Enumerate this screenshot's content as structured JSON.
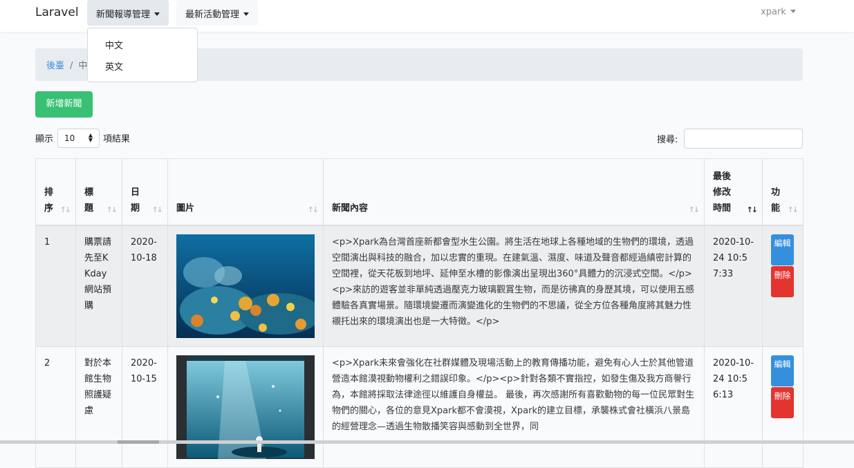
{
  "navbar": {
    "brand": "Laravel",
    "menus": [
      {
        "label": "新聞報導管理"
      },
      {
        "label": "最新活動管理"
      }
    ],
    "user": "xpark",
    "dropdown_items": [
      "中文",
      "英文"
    ]
  },
  "breadcrumb": {
    "home": "後臺",
    "current": "中文"
  },
  "add_button": "新增新聞",
  "length": {
    "prefix": "顯示",
    "value": "10",
    "suffix": "項結果"
  },
  "search": {
    "label": "搜尋:",
    "value": ""
  },
  "table": {
    "headers": [
      "排序",
      "標題",
      "日期",
      "圖片",
      "新聞內容",
      "最後修改時間",
      "功能"
    ],
    "rows": [
      {
        "order": "1",
        "title": "購票請先至KKday網站預購",
        "date": "2020-10-18",
        "image": "coral-reef-image",
        "content": "<p>Xpark為台灣首座新都會型水生公園。將生活在地球上各種地域的生物們的環境，透過空間演出與科技的融合，加以忠實的重現。在建氣溫、濕度、味道及聲音都經過縝密計算的空間裡，從天花板到地坪、延伸至水槽的影像演出呈現出360°具體力的沉浸式空間。</p><p>來訪的遊客並非單純透過壓克力玻璃觀賞生物，而是彷彿真的身歷其境，可以使用五感體驗各真實場景。隨環境變遷而演變進化的生物們的不思議，從全方位各種角度將其魅力性襯托出來的環境演出也是一大特徵。</p>",
        "updated": "2020-10-24 10:57:33",
        "edit": "編輯",
        "delete": "刪除"
      },
      {
        "order": "2",
        "title": "對於本館生物照護疑慮",
        "date": "2020-10-15",
        "image": "aquarium-tank-image",
        "content": "<p>Xpark未來會強化在社群媒體及現場活動上的教育傳播功能，避免有心人士於其他管道營造本館漠視動物權利之錯誤印象。</p><p>針對各類不實指控，如發生傷及我方商譽行為，本館將採取法律途徑以維護自身權益。 最後，再次感謝所有喜歡動物的每一位民眾對生物們的關心，各位的意見Xpark都不會漠視，Xpark的建立目標，承襲株式會社橫浜八景島的經營理念—透過生物散播笑容與感動到全世界，同",
        "updated": "2020-10-24 10:56:13",
        "edit": "編輯",
        "delete": "刪除"
      }
    ]
  },
  "colors": {
    "add": "#38c172",
    "edit": "#3490dc",
    "delete": "#e3342f",
    "link": "#3490dc"
  }
}
